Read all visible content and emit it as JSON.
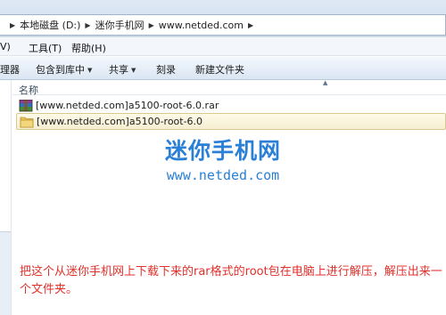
{
  "address_bar": {
    "segments": [
      "本地磁盘 (D:)",
      "迷你手机网",
      "www.netded.com"
    ]
  },
  "menu": {
    "items": [
      "V)",
      "工具(T)",
      "帮助(H)"
    ]
  },
  "toolbar": {
    "organize_label": "理器",
    "include_label": "包含到库中",
    "share_label": "共享",
    "burn_label": "刻录",
    "new_folder_label": "新建文件夹"
  },
  "columns": {
    "name_label": "名称"
  },
  "files": [
    {
      "name": "[www.netded.com]a5100-root-6.0.rar",
      "icon": "winrar-archive-icon"
    },
    {
      "name": "[www.netded.com]a5100-root-6.0",
      "icon": "folder-icon"
    }
  ],
  "watermark": {
    "title": "迷你手机网",
    "url": "www.netded.com"
  },
  "instruction": {
    "text": "把这个从迷你手机网上下载下来的rar格式的root包在电脑上进行解压，解压出来一个文件夹。"
  },
  "colors": {
    "watermark": "#2a7fd6",
    "instruction": "#e0312b",
    "selection": "#f6eed0"
  }
}
